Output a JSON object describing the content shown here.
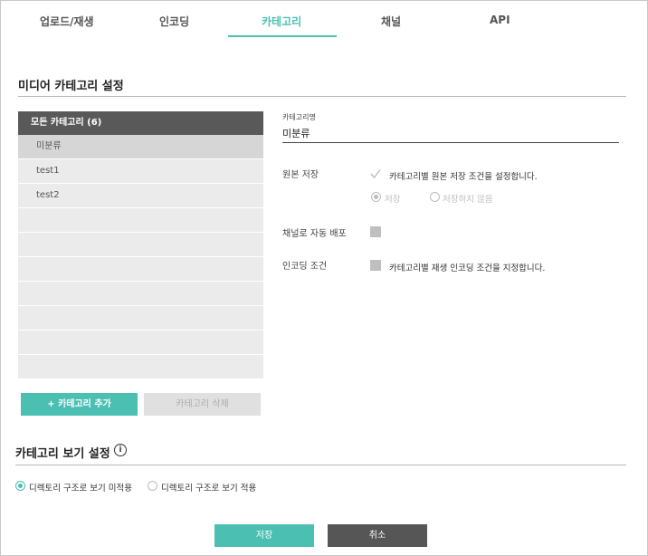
{
  "tabs": [
    {
      "label": "업로드/재생"
    },
    {
      "label": "인코딩"
    },
    {
      "label": "카테고리"
    },
    {
      "label": "채널"
    },
    {
      "label": "API"
    }
  ],
  "active_tab": "카테고리",
  "media_category": {
    "title": "미디어 카테고리 설정",
    "list_header": "모든 카테고리 (6)",
    "items": [
      "미분류",
      "test1",
      "test2",
      "",
      "",
      "",
      "",
      "",
      "",
      ""
    ],
    "selected_item": "미분류",
    "add_button": "+ 카테고리 추가",
    "delete_button": "카테고리 삭제"
  },
  "form": {
    "name_label": "카테고리명",
    "name_value": "미분류",
    "original_storage": {
      "label": "원본 저장",
      "description": "카테고리별 원본 저장 조건을 설정합니다.",
      "option_save": "저장",
      "option_no_save": "저장하지 않음",
      "selected": "저장"
    },
    "auto_channel": {
      "label": "채널로 자동 배포"
    },
    "encoding_condition": {
      "label": "인코딩 조건",
      "description": "카테고리별 재생 인코딩 조건을 지정합니다."
    }
  },
  "category_view": {
    "title": "카테고리 보기 설정",
    "info_glyph": "i",
    "option_off": "디렉토리 구조로 보기 미적용",
    "option_on": "디렉토리 구조로 보기 적용",
    "selected": "디렉토리 구조로 보기 미적용"
  },
  "footer": {
    "save_label": "저장",
    "cancel_label": "취소"
  },
  "colors": {
    "accent": "#4cbfb3",
    "list_header_bg": "#595959",
    "cancel_bg": "#565656"
  }
}
